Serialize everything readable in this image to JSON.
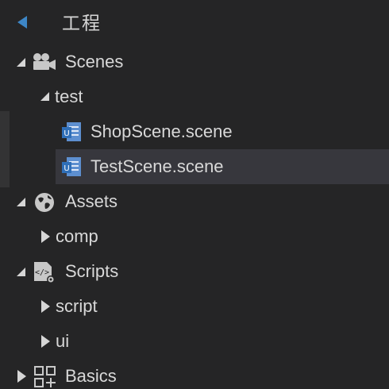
{
  "panel": {
    "title": "工程"
  },
  "tree": {
    "scenes": {
      "label": "Scenes",
      "icon": "camera-icon"
    },
    "test": {
      "label": "test"
    },
    "shop_scene": {
      "label": "ShopScene.scene",
      "icon": "scene-file-icon"
    },
    "test_scene": {
      "label": "TestScene.scene",
      "icon": "scene-file-icon",
      "selected": true
    },
    "assets": {
      "label": "Assets",
      "icon": "globe-icon"
    },
    "comp": {
      "label": "comp"
    },
    "scripts": {
      "label": "Scripts",
      "icon": "code-file-icon"
    },
    "script": {
      "label": "script"
    },
    "ui": {
      "label": "ui"
    },
    "basics": {
      "label": "Basics",
      "icon": "grid-plus-icon"
    }
  },
  "colors": {
    "background": "#252526",
    "selection": "#37373d",
    "accent": "#3d86c6",
    "text": "#d8d8d8"
  }
}
